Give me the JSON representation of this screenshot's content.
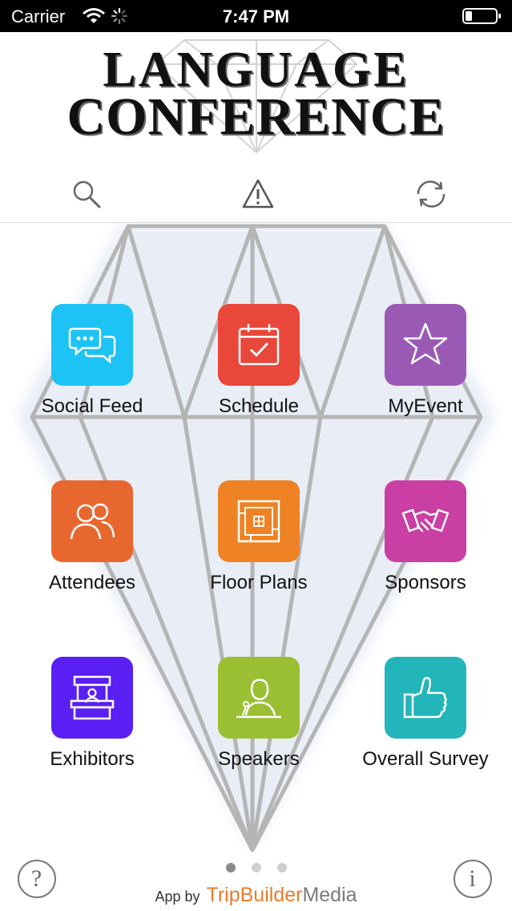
{
  "status_bar": {
    "carrier": "Carrier",
    "time": "7:47 PM"
  },
  "header": {
    "title_line_1": "LANGUAGE",
    "title_line_2": "CONFERENCE"
  },
  "toolbar": {
    "icons": [
      "search-icon",
      "alert-icon",
      "refresh-icon"
    ]
  },
  "grid": {
    "items": [
      {
        "label": "Social Feed",
        "color": "#1ec3f5",
        "icon": "chat-bubbles-icon"
      },
      {
        "label": "Schedule",
        "color": "#e8473a",
        "icon": "calendar-icon"
      },
      {
        "label": "MyEvent",
        "color": "#9b59b6",
        "icon": "star-icon"
      },
      {
        "label": "Attendees",
        "color": "#e8672f",
        "icon": "people-icon"
      },
      {
        "label": "Floor Plans",
        "color": "#ee8224",
        "icon": "floor-plan-icon"
      },
      {
        "label": "Sponsors",
        "color": "#c93fa3",
        "icon": "handshake-icon"
      },
      {
        "label": "Exhibitors",
        "color": "#5a1ff2",
        "icon": "booth-icon"
      },
      {
        "label": "Speakers",
        "color": "#9bbf32",
        "icon": "speaker-icon"
      },
      {
        "label": "Overall Survey",
        "color": "#22b5b9",
        "icon": "thumbs-up-icon"
      }
    ]
  },
  "pager": {
    "pages": 3,
    "active": 1
  },
  "footer": {
    "help_label": "?",
    "info_label": "i",
    "credit_prefix": "App by",
    "brand_part_1": "TripBuilder",
    "brand_part_2": "Media"
  }
}
